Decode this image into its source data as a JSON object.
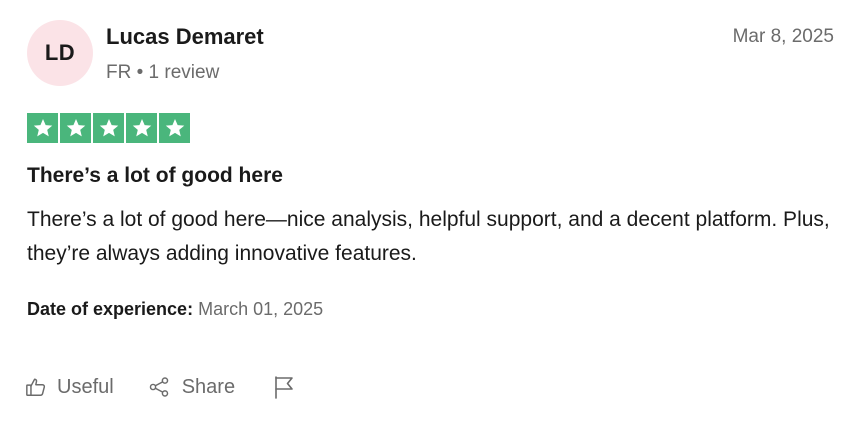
{
  "reviewer": {
    "initials": "LD",
    "name": "Lucas Demaret",
    "meta": "FR • 1 review",
    "avatar_color": "#fbe3e7"
  },
  "review": {
    "date": "Mar 8, 2025",
    "rating": 5,
    "rating_max": 5,
    "star_color": "#4ab67c",
    "title": "There’s a lot of good here",
    "body": "There’s a lot of good here—nice analysis, helpful support, and a decent platform. Plus, they’re always adding innovative features.",
    "experience_label": "Date of experience:",
    "experience_value": "March 01, 2025"
  },
  "actions": {
    "useful_label": "Useful",
    "useful_icon": "thumbs-up-icon",
    "share_label": "Share",
    "share_icon": "share-icon",
    "report_icon": "flag-icon"
  }
}
